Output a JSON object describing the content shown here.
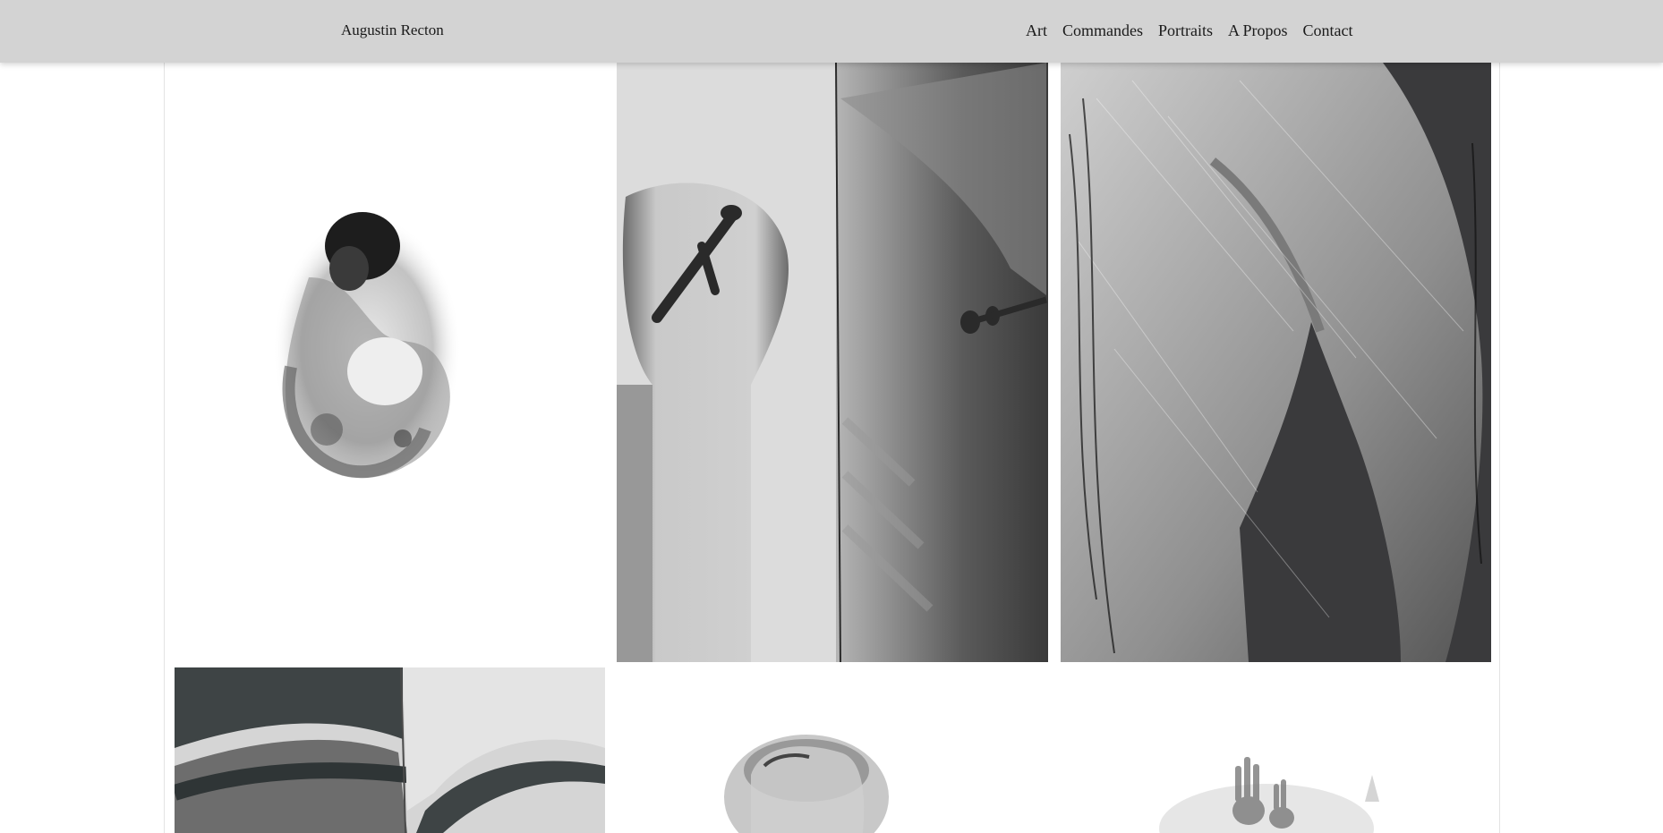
{
  "header": {
    "brand": "Augustin Recton",
    "nav": [
      "Art",
      "Commandes",
      "Portraits",
      "A Propos",
      "Contact"
    ]
  },
  "gallery": {
    "images": [
      {
        "icon": "ink-mother-child-artwork"
      },
      {
        "icon": "xray-shoulder-screw-artwork"
      },
      {
        "icon": "scratched-shoulder-scar-artwork"
      },
      {
        "icon": "skin-fold-closeup-artwork"
      },
      {
        "icon": "ink-head-artwork"
      },
      {
        "icon": "ink-raised-hands-artwork"
      }
    ]
  },
  "colors": {
    "header_bg": "#d3d3d3",
    "text": "#1a1a1a",
    "frame_border": "#e3e3e3"
  }
}
